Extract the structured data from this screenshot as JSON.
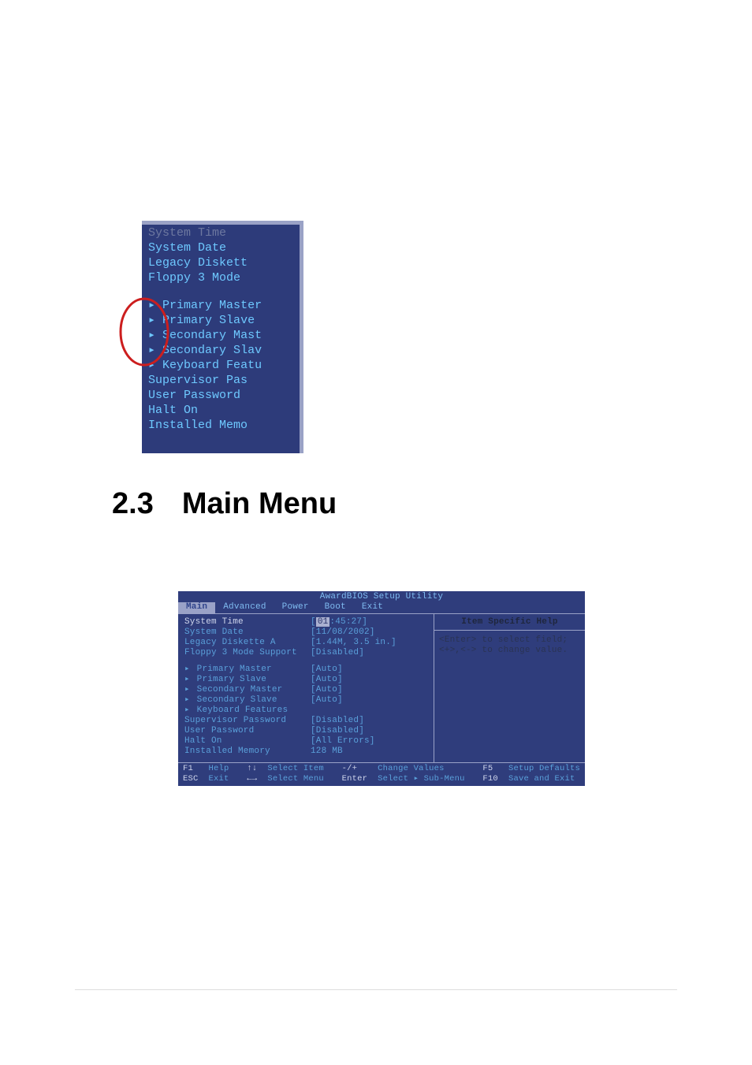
{
  "heading": {
    "number": "2.3",
    "title": "Main Menu"
  },
  "snippet": {
    "systemTime": "System Time",
    "systemDate": "System Date",
    "legacyDiskette": "Legacy Diskett",
    "floppy": "Floppy 3 Mode",
    "primaryMaster": "Primary Master",
    "primarySlave": "Primary Slave",
    "secondaryMaster": "Secondary Mast",
    "secondarySlave": "Secondary Slav",
    "keyboardFeatures": "Keyboard Featu",
    "supervisorPassword": "Supervisor Pas",
    "userPassword": "User Password",
    "haltOn": "Halt On",
    "installedMemory": "Installed Memo"
  },
  "bios": {
    "title": "AwardBIOS Setup Utility",
    "tabs": {
      "main": "Main",
      "advanced": "Advanced",
      "power": "Power",
      "boot": "Boot",
      "exit": "Exit"
    },
    "help": {
      "title": "Item Specific Help",
      "line1": "<Enter> to select field;",
      "line2": "<+>,<-> to change value."
    },
    "fields": {
      "systemTime": {
        "label": "System Time",
        "value": "[01:45:27]",
        "cursor": "01",
        "rest": ":45:27]"
      },
      "systemDate": {
        "label": "System Date",
        "value": "[11/08/2002]"
      },
      "legacyDisketteA": {
        "label": "Legacy Diskette A",
        "value": "[1.44M, 3.5 in.]"
      },
      "floppy3": {
        "label": "Floppy 3 Mode Support",
        "value": "[Disabled]"
      },
      "primaryMaster": {
        "label": "Primary Master",
        "value": "[Auto]"
      },
      "primarySlave": {
        "label": "Primary Slave",
        "value": "[Auto]"
      },
      "secondaryMaster": {
        "label": "Secondary Master",
        "value": "[Auto]"
      },
      "secondarySlave": {
        "label": "Secondary Slave",
        "value": "[Auto]"
      },
      "keyboardFeatures": {
        "label": "Keyboard Features",
        "value": ""
      },
      "supervisorPassword": {
        "label": "Supervisor Password",
        "value": "[Disabled]"
      },
      "userPassword": {
        "label": "User Password",
        "value": "[Disabled]"
      },
      "haltOn": {
        "label": "Halt On",
        "value": "[All Errors]"
      },
      "installedMemory": {
        "label": "Installed Memory",
        "value": "128 MB"
      }
    },
    "footer": {
      "f1": "F1",
      "f1desc": "Help",
      "esc": "ESC",
      "escdesc": "Exit",
      "updown": "↑↓",
      "updowndesc": "Select Item",
      "leftright": "←→",
      "leftrightdesc": "Select Menu",
      "plusminus": "-/+",
      "plusminusdesc": "Change Values",
      "enter": "Enter",
      "enterdesc": "Select ▸ Sub-Menu",
      "f5": "F5",
      "f5desc": "Setup Defaults",
      "f10": "F10",
      "f10desc": "Save and Exit"
    }
  }
}
